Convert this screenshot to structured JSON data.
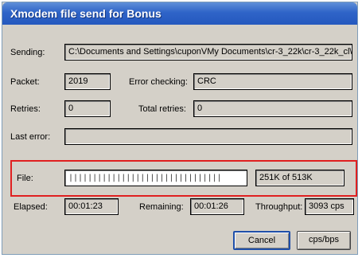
{
  "window": {
    "title": "Xmodem file send for Bonus"
  },
  "sending": {
    "label": "Sending:",
    "value": "C:\\Documents and Settings\\cuponVMy Documents\\cr-3_22k\\cr-3_22k_cl\\"
  },
  "packet": {
    "label": "Packet:",
    "value": "2019"
  },
  "error_checking": {
    "label": "Error checking:",
    "value": "CRC"
  },
  "retries": {
    "label": "Retries:",
    "value": "0"
  },
  "total_retries": {
    "label": "Total retries:",
    "value": "0"
  },
  "last_error": {
    "label": "Last error:",
    "value": ""
  },
  "file": {
    "label": "File:",
    "progress_chars": "||||||||||||||||||||||||||||||||",
    "size_text": "251K of 513K",
    "progress_fraction": 0.49
  },
  "elapsed": {
    "label": "Elapsed:",
    "value": "00:01:23"
  },
  "remaining": {
    "label": "Remaining:",
    "value": "00:01:26"
  },
  "throughput": {
    "label": "Throughput:",
    "value": "3093 cps"
  },
  "buttons": {
    "cancel": "Cancel",
    "cps_bps": "cps/bps"
  },
  "colors": {
    "title_bar": "#2f64c8",
    "dialog_bg": "#d4d0c8",
    "highlight": "#e02020"
  }
}
